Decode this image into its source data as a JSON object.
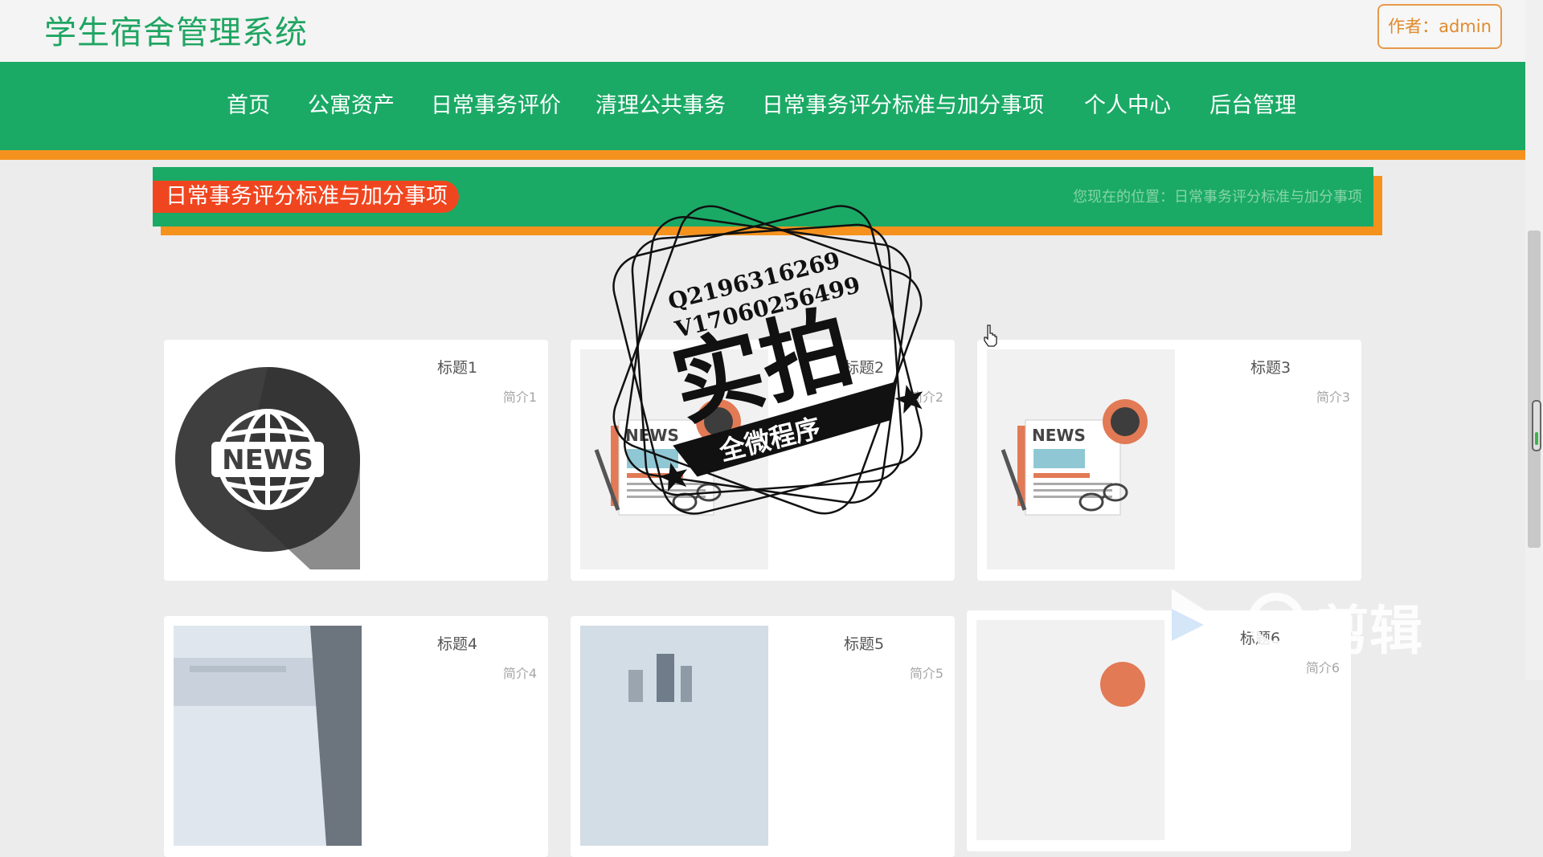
{
  "header": {
    "site_title": "学生宿舍管理系统",
    "author_label": "作者：admin"
  },
  "nav": {
    "items": [
      {
        "label": "首页"
      },
      {
        "label": "公寓资产"
      },
      {
        "label": "日常事务评价"
      },
      {
        "label": "清理公共事务"
      },
      {
        "label": "日常事务评分标准与加分事项"
      },
      {
        "label": "个人中心"
      },
      {
        "label": "后台管理"
      }
    ]
  },
  "section": {
    "title": "日常事务评分标准与加分事项",
    "breadcrumb": "您现在的位置：日常事务评分标准与加分事项"
  },
  "cards": [
    {
      "title": "标题1",
      "intro": "简介1",
      "image": "news-globe-icon"
    },
    {
      "title": "标题2",
      "intro": "简介2",
      "image": "newspaper-coffee-illustration"
    },
    {
      "title": "标题3",
      "intro": "简介3",
      "image": "newspaper-coffee-illustration"
    },
    {
      "title": "标题4",
      "intro": "简介4",
      "image": "building-photo"
    },
    {
      "title": "标题5",
      "intro": "简介5",
      "image": "city-photo"
    },
    {
      "title": "标题6",
      "intro": "简介6",
      "image": "coffee-cup-illustration"
    }
  ],
  "stamp": {
    "line1": "Q2196316269",
    "line2": "V17060256499",
    "main_text": "实拍",
    "ribbon_text": "全微程序"
  },
  "watermark": {
    "text": "剪辑"
  },
  "colors": {
    "brand_green": "#1aaa66",
    "accent_orange": "#f5921e",
    "title_red": "#f0461f",
    "site_title_green": "#1fa562",
    "author_orange": "#e08a2c"
  }
}
